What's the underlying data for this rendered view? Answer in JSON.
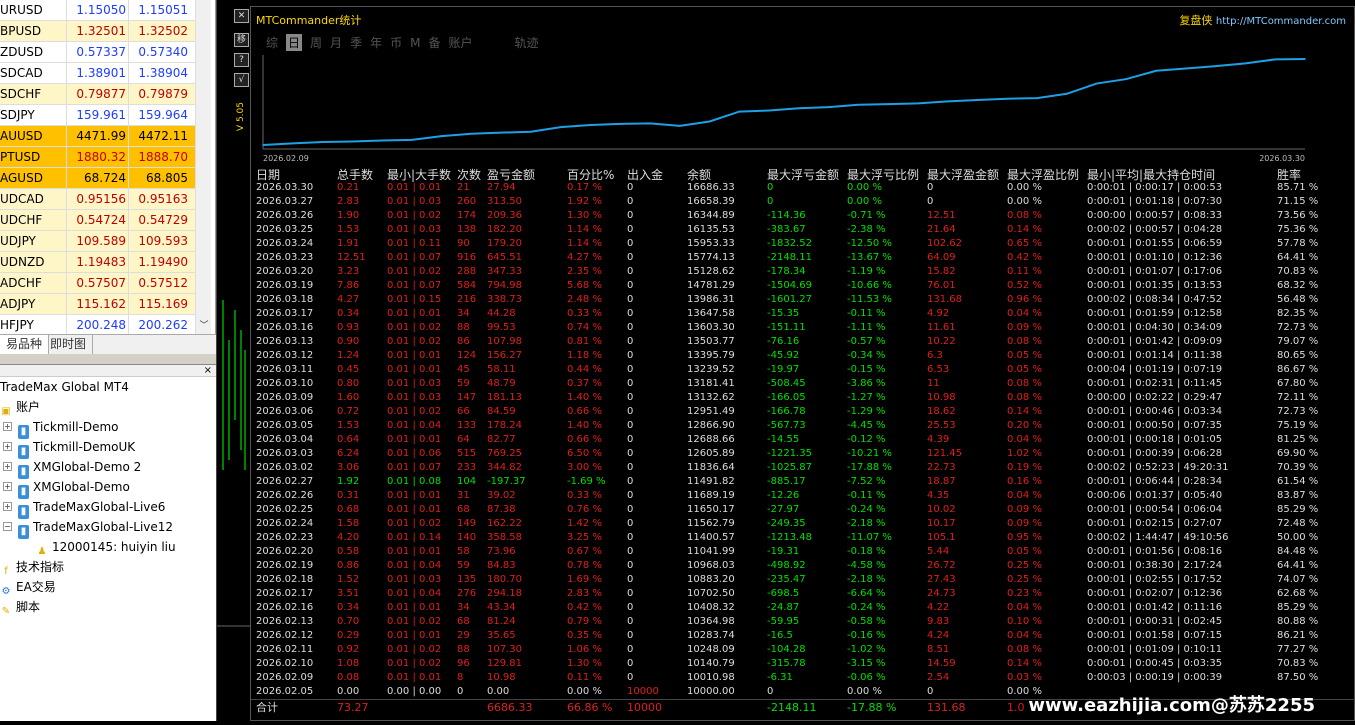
{
  "market_watch": {
    "rows": [
      {
        "symbol": "URUSD",
        "bid": "1.15050",
        "ask": "1.15051",
        "bg": "#ffffff",
        "color": "#1e3cff"
      },
      {
        "symbol": "BPUSD",
        "bid": "1.32501",
        "ask": "1.32502",
        "bg": "#fff6c8",
        "color": "#c00000"
      },
      {
        "symbol": "ZDUSD",
        "bid": "0.57337",
        "ask": "0.57340",
        "bg": "#ffffff",
        "color": "#1e3cff"
      },
      {
        "symbol": "SDCAD",
        "bid": "1.38901",
        "ask": "1.38904",
        "bg": "#ffffff",
        "color": "#1e3cff"
      },
      {
        "symbol": "SDCHF",
        "bid": "0.79877",
        "ask": "0.79879",
        "bg": "#fff6c8",
        "color": "#c00000"
      },
      {
        "symbol": "SDJPY",
        "bid": "159.961",
        "ask": "159.964",
        "bg": "#ffffff",
        "color": "#1e3cff"
      },
      {
        "symbol": "AUUSD",
        "bid": "4471.99",
        "ask": "4472.11",
        "bg": "#ffc000",
        "color": "#000000"
      },
      {
        "symbol": "PTUSD",
        "bid": "1880.32",
        "ask": "1888.70",
        "bg": "#ffc000",
        "color": "#c00000"
      },
      {
        "symbol": "AGUSD",
        "bid": "68.724",
        "ask": "68.805",
        "bg": "#ffc000",
        "color": "#000000"
      },
      {
        "symbol": "UDCAD",
        "bid": "0.95156",
        "ask": "0.95163",
        "bg": "#fff6c8",
        "color": "#c00000"
      },
      {
        "symbol": "UDCHF",
        "bid": "0.54724",
        "ask": "0.54729",
        "bg": "#fff6c8",
        "color": "#c00000"
      },
      {
        "symbol": "UDJPY",
        "bid": "109.589",
        "ask": "109.593",
        "bg": "#fff6c8",
        "color": "#c00000"
      },
      {
        "symbol": "UDNZD",
        "bid": "1.19483",
        "ask": "1.19490",
        "bg": "#fff6c8",
        "color": "#c00000"
      },
      {
        "symbol": "ADCHF",
        "bid": "0.57507",
        "ask": "0.57512",
        "bg": "#fff6c8",
        "color": "#c00000"
      },
      {
        "symbol": "ADJPY",
        "bid": "115.162",
        "ask": "115.169",
        "bg": "#fff6c8",
        "color": "#c00000"
      },
      {
        "symbol": "HFJPY",
        "bid": "200.248",
        "ask": "200.262",
        "bg": "#ffffff",
        "color": "#1e3cff"
      }
    ],
    "tab_symbols": "易品种",
    "tab_tick": "即时图"
  },
  "navigator": {
    "root": "TradeMax Global MT4",
    "accounts_label": "账户",
    "accounts": [
      "Tickmill-Demo",
      "Tickmill-DemoUK",
      "XMGlobal-Demo 2",
      "XMGlobal-Demo",
      "TradeMaxGlobal-Live6",
      "TradeMaxGlobal-Live12"
    ],
    "sub_account": "12000145: huiyin liu",
    "indicators": "技术指标",
    "ea": "EA交易",
    "scripts": "脚本"
  },
  "panel": {
    "title": "MTCommander统计",
    "brand": "复盘侠",
    "url": "http://MTCommander.com",
    "side_buttons": [
      "移",
      "?",
      "√"
    ],
    "version": "V 5.05",
    "menu": [
      "综",
      "日",
      "周",
      "月",
      "季",
      "年",
      "币",
      "M",
      "备",
      "账户"
    ],
    "menu_active": "日",
    "track": "轨迹",
    "chart_start": "2026.02.09",
    "chart_end": "2026.03.30"
  },
  "chart_data": {
    "type": "line",
    "x": [
      "2026.02.09",
      "2026.02.10",
      "2026.02.11",
      "2026.02.12",
      "2026.02.13",
      "2026.02.16",
      "2026.02.17",
      "2026.02.18",
      "2026.02.19",
      "2026.02.20",
      "2026.02.23",
      "2026.02.24",
      "2026.02.25",
      "2026.02.26",
      "2026.02.27",
      "2026.03.02",
      "2026.03.03",
      "2026.03.04",
      "2026.03.05",
      "2026.03.06",
      "2026.03.09",
      "2026.03.10",
      "2026.03.11",
      "2026.03.12",
      "2026.03.13",
      "2026.03.16",
      "2026.03.17",
      "2026.03.18",
      "2026.03.19",
      "2026.03.20",
      "2026.03.23",
      "2026.03.24",
      "2026.03.25",
      "2026.03.26",
      "2026.03.27",
      "2026.03.30"
    ],
    "series": [
      {
        "values": [
          10010.98,
          10140.79,
          10248.09,
          10283.74,
          10364.98,
          10408.32,
          10702.5,
          10883.2,
          10968.03,
          11041.99,
          11400.57,
          11562.79,
          11650.17,
          11689.19,
          11491.82,
          11836.64,
          12605.89,
          12688.66,
          12866.9,
          12951.49,
          13132.62,
          13181.41,
          13239.52,
          13395.79,
          13503.77,
          13603.3,
          13647.58,
          13986.31,
          14781.29,
          15128.62,
          15774.13,
          15953.33,
          16135.53,
          16344.89,
          16658.39,
          16686.33
        ]
      }
    ],
    "xlim": [
      "2026.02.09",
      "2026.03.30"
    ],
    "line_color": "#1ea0e6"
  },
  "table": {
    "headers": [
      "日期",
      "总手数",
      "最小|大手数",
      "次数",
      "盈亏金额",
      "百分比%",
      "出入金",
      "余额",
      "最大浮亏金额",
      "最大浮亏比例",
      "最大浮盈金额",
      "最大浮盈比例",
      "最小|平均|最大持仓时间",
      "胜率"
    ],
    "rows": [
      [
        "2026.03.30",
        "0.21",
        "0.01 | 0.01",
        "21",
        "27.94",
        "0.17 %",
        "0",
        "16686.33",
        "0",
        "0.00 %",
        "0",
        "0.00 %",
        "0:00:01 | 0:00:17 | 0:00:53",
        "85.71 %"
      ],
      [
        "2026.03.27",
        "2.83",
        "0.01 | 0.03",
        "260",
        "313.50",
        "1.92 %",
        "0",
        "16658.39",
        "0",
        "0.00 %",
        "0",
        "0.00 %",
        "0:00:01 | 0:01:18 | 0:07:30",
        "71.15 %"
      ],
      [
        "2026.03.26",
        "1.90",
        "0.01 | 0.02",
        "174",
        "209.36",
        "1.30 %",
        "0",
        "16344.89",
        "-114.36",
        "-0.71 %",
        "12.51",
        "0.08 %",
        "0:00:00 | 0:00:57 | 0:08:33",
        "73.56 %"
      ],
      [
        "2026.03.25",
        "1.53",
        "0.01 | 0.03",
        "138",
        "182.20",
        "1.14 %",
        "0",
        "16135.53",
        "-383.67",
        "-2.38 %",
        "21.64",
        "0.14 %",
        "0:00:02 | 0:00:57 | 0:04:28",
        "75.36 %"
      ],
      [
        "2026.03.24",
        "1.91",
        "0.01 | 0.11",
        "90",
        "179.20",
        "1.14 %",
        "0",
        "15953.33",
        "-1832.52",
        "-12.50 %",
        "102.62",
        "0.65 %",
        "0:00:01 | 0:01:55 | 0:06:59",
        "57.78 %"
      ],
      [
        "2026.03.23",
        "12.51",
        "0.01 | 0.07",
        "916",
        "645.51",
        "4.27 %",
        "0",
        "15774.13",
        "-2148.11",
        "-13.67 %",
        "64.09",
        "0.42 %",
        "0:00:01 | 0:01:10 | 0:12:36",
        "64.41 %"
      ],
      [
        "2026.03.20",
        "3.23",
        "0.01 | 0.02",
        "288",
        "347.33",
        "2.35 %",
        "0",
        "15128.62",
        "-178.34",
        "-1.19 %",
        "15.82",
        "0.11 %",
        "0:00:01 | 0:01:07 | 0:17:06",
        "70.83 %"
      ],
      [
        "2026.03.19",
        "7.86",
        "0.01 | 0.07",
        "584",
        "794.98",
        "5.68 %",
        "0",
        "14781.29",
        "-1504.69",
        "-10.66 %",
        "76.01",
        "0.52 %",
        "0:00:01 | 0:01:35 | 0:13:53",
        "68.32 %"
      ],
      [
        "2026.03.18",
        "4.27",
        "0.01 | 0.15",
        "216",
        "338.73",
        "2.48 %",
        "0",
        "13986.31",
        "-1601.27",
        "-11.53 %",
        "131.68",
        "0.96 %",
        "0:00:02 | 0:08:34 | 0:47:52",
        "56.48 %"
      ],
      [
        "2026.03.17",
        "0.34",
        "0.01 | 0.01",
        "34",
        "44.28",
        "0.33 %",
        "0",
        "13647.58",
        "-15.35",
        "-0.11 %",
        "4.92",
        "0.04 %",
        "0:00:01 | 0:01:59 | 0:12:58",
        "82.35 %"
      ],
      [
        "2026.03.16",
        "0.93",
        "0.01 | 0.02",
        "88",
        "99.53",
        "0.74 %",
        "0",
        "13603.30",
        "-151.11",
        "-1.11 %",
        "11.61",
        "0.09 %",
        "0:00:01 | 0:04:30 | 0:34:09",
        "72.73 %"
      ],
      [
        "2026.03.13",
        "0.90",
        "0.01 | 0.02",
        "86",
        "107.98",
        "0.81 %",
        "0",
        "13503.77",
        "-76.16",
        "-0.57 %",
        "10.22",
        "0.08 %",
        "0:00:01 | 0:01:42 | 0:09:09",
        "79.07 %"
      ],
      [
        "2026.03.12",
        "1.24",
        "0.01 | 0.01",
        "124",
        "156.27",
        "1.18 %",
        "0",
        "13395.79",
        "-45.92",
        "-0.34 %",
        "6.3",
        "0.05 %",
        "0:00:01 | 0:01:14 | 0:11:38",
        "80.65 %"
      ],
      [
        "2026.03.11",
        "0.45",
        "0.01 | 0.01",
        "45",
        "58.11",
        "0.44 %",
        "0",
        "13239.52",
        "-19.97",
        "-0.15 %",
        "6.53",
        "0.05 %",
        "0:00:04 | 0:01:19 | 0:07:19",
        "86.67 %"
      ],
      [
        "2026.03.10",
        "0.80",
        "0.01 | 0.03",
        "59",
        "48.79",
        "0.37 %",
        "0",
        "13181.41",
        "-508.45",
        "-3.86 %",
        "11",
        "0.08 %",
        "0:00:01 | 0:02:31 | 0:11:45",
        "67.80 %"
      ],
      [
        "2026.03.09",
        "1.60",
        "0.01 | 0.03",
        "147",
        "181.13",
        "1.40 %",
        "0",
        "13132.62",
        "-166.05",
        "-1.27 %",
        "10.98",
        "0.08 %",
        "0:00:00 | 0:02:22 | 0:29:47",
        "72.11 %"
      ],
      [
        "2026.03.06",
        "0.72",
        "0.01 | 0.02",
        "66",
        "84.59",
        "0.66 %",
        "0",
        "12951.49",
        "-166.78",
        "-1.29 %",
        "18.62",
        "0.14 %",
        "0:00:01 | 0:00:46 | 0:03:34",
        "72.73 %"
      ],
      [
        "2026.03.05",
        "1.53",
        "0.01 | 0.04",
        "133",
        "178.24",
        "1.40 %",
        "0",
        "12866.90",
        "-567.73",
        "-4.45 %",
        "25.53",
        "0.20 %",
        "0:00:01 | 0:00:50 | 0:07:35",
        "75.19 %"
      ],
      [
        "2026.03.04",
        "0.64",
        "0.01 | 0.01",
        "64",
        "82.77",
        "0.66 %",
        "0",
        "12688.66",
        "-14.55",
        "-0.12 %",
        "4.39",
        "0.04 %",
        "0:00:01 | 0:00:18 | 0:01:05",
        "81.25 %"
      ],
      [
        "2026.03.03",
        "6.24",
        "0.01 | 0.06",
        "515",
        "769.25",
        "6.50 %",
        "0",
        "12605.89",
        "-1221.35",
        "-10.21 %",
        "121.45",
        "1.02 %",
        "0:00:01 | 0:00:39 | 0:06:28",
        "69.90 %"
      ],
      [
        "2026.03.02",
        "3.06",
        "0.01 | 0.07",
        "233",
        "344.82",
        "3.00 %",
        "0",
        "11836.64",
        "-1025.87",
        "-17.88 %",
        "22.73",
        "0.19 %",
        "0:00:02 | 0:52:23 | 49:20:31",
        "70.39 %"
      ],
      [
        "2026.02.27",
        "1.92",
        "0.01 | 0.08",
        "104",
        "-197.37",
        "-1.69 %",
        "0",
        "11491.82",
        "-885.17",
        "-7.52 %",
        "18.87",
        "0.16 %",
        "0:00:01 | 0:06:44 | 0:28:34",
        "61.54 %"
      ],
      [
        "2026.02.26",
        "0.31",
        "0.01 | 0.01",
        "31",
        "39.02",
        "0.33 %",
        "0",
        "11689.19",
        "-12.26",
        "-0.11 %",
        "4.35",
        "0.04 %",
        "0:00:06 | 0:01:37 | 0:05:40",
        "83.87 %"
      ],
      [
        "2026.02.25",
        "0.68",
        "0.01 | 0.01",
        "68",
        "87.38",
        "0.76 %",
        "0",
        "11650.17",
        "-27.97",
        "-0.24 %",
        "10.02",
        "0.09 %",
        "0:00:01 | 0:00:54 | 0:06:04",
        "85.29 %"
      ],
      [
        "2026.02.24",
        "1.58",
        "0.01 | 0.02",
        "149",
        "162.22",
        "1.42 %",
        "0",
        "11562.79",
        "-249.35",
        "-2.18 %",
        "10.17",
        "0.09 %",
        "0:00:01 | 0:02:15 | 0:27:07",
        "72.48 %"
      ],
      [
        "2026.02.23",
        "4.20",
        "0.01 | 0.14",
        "140",
        "358.58",
        "3.25 %",
        "0",
        "11400.57",
        "-1213.48",
        "-11.07 %",
        "105.1",
        "0.95 %",
        "0:00:02 | 1:44:47 | 49:10:56",
        "50.00 %"
      ],
      [
        "2026.02.20",
        "0.58",
        "0.01 | 0.01",
        "58",
        "73.96",
        "0.67 %",
        "0",
        "11041.99",
        "-19.31",
        "-0.18 %",
        "5.44",
        "0.05 %",
        "0:00:01 | 0:01:56 | 0:08:16",
        "84.48 %"
      ],
      [
        "2026.02.19",
        "0.86",
        "0.01 | 0.04",
        "59",
        "84.83",
        "0.78 %",
        "0",
        "10968.03",
        "-498.92",
        "-4.58 %",
        "26.72",
        "0.25 %",
        "0:00:01 | 0:38:30 | 2:17:24",
        "64.41 %"
      ],
      [
        "2026.02.18",
        "1.52",
        "0.01 | 0.03",
        "135",
        "180.70",
        "1.69 %",
        "0",
        "10883.20",
        "-235.47",
        "-2.18 %",
        "27.43",
        "0.25 %",
        "0:00:01 | 0:02:55 | 0:17:52",
        "74.07 %"
      ],
      [
        "2026.02.17",
        "3.51",
        "0.01 | 0.04",
        "276",
        "294.18",
        "2.83 %",
        "0",
        "10702.50",
        "-698.5",
        "-6.64 %",
        "24.73",
        "0.23 %",
        "0:00:01 | 0:02:07 | 0:12:36",
        "62.68 %"
      ],
      [
        "2026.02.16",
        "0.34",
        "0.01 | 0.01",
        "34",
        "43.34",
        "0.42 %",
        "0",
        "10408.32",
        "-24.87",
        "-0.24 %",
        "4.22",
        "0.04 %",
        "0:00:01 | 0:01:42 | 0:11:16",
        "85.29 %"
      ],
      [
        "2026.02.13",
        "0.70",
        "0.01 | 0.02",
        "68",
        "81.24",
        "0.79 %",
        "0",
        "10364.98",
        "-59.95",
        "-0.58 %",
        "9.83",
        "0.10 %",
        "0:00:01 | 0:00:31 | 0:02:45",
        "80.88 %"
      ],
      [
        "2026.02.12",
        "0.29",
        "0.01 | 0.01",
        "29",
        "35.65",
        "0.35 %",
        "0",
        "10283.74",
        "-16.5",
        "-0.16 %",
        "4.24",
        "0.04 %",
        "0:00:01 | 0:01:58 | 0:07:15",
        "86.21 %"
      ],
      [
        "2026.02.11",
        "0.92",
        "0.01 | 0.02",
        "88",
        "107.30",
        "1.06 %",
        "0",
        "10248.09",
        "-104.28",
        "-1.02 %",
        "8.51",
        "0.08 %",
        "0:00:01 | 0:01:09 | 0:10:11",
        "77.27 %"
      ],
      [
        "2026.02.10",
        "1.08",
        "0.01 | 0.02",
        "96",
        "129.81",
        "1.30 %",
        "0",
        "10140.79",
        "-315.78",
        "-3.15 %",
        "14.59",
        "0.14 %",
        "0:00:01 | 0:00:45 | 0:03:35",
        "70.83 %"
      ],
      [
        "2026.02.09",
        "0.08",
        "0.01 | 0.01",
        "8",
        "10.98",
        "0.11 %",
        "0",
        "10010.98",
        "-6.31",
        "-0.06 %",
        "2.54",
        "0.03 %",
        "0:00:03 | 0:00:19 | 0:00:39",
        "87.50 %"
      ],
      [
        "2026.02.05",
        "0.00",
        "0.00 | 0.00",
        "0",
        "0.00",
        "0.00 %",
        "10000",
        "10000.00",
        "0",
        "0.00 %",
        "0",
        "0.00 %",
        "",
        ""
      ]
    ],
    "total": {
      "label": "合计",
      "lots": "73.27",
      "pnl": "6686.33",
      "pct": "66.86 %",
      "deposit": "10000",
      "max_dd": "-2148.11",
      "max_dd_pct": "-17.88 %",
      "max_fp": "131.68",
      "max_fp_pct": "1.0"
    }
  },
  "watermark": "www.eazhijia.com@苏苏2255"
}
